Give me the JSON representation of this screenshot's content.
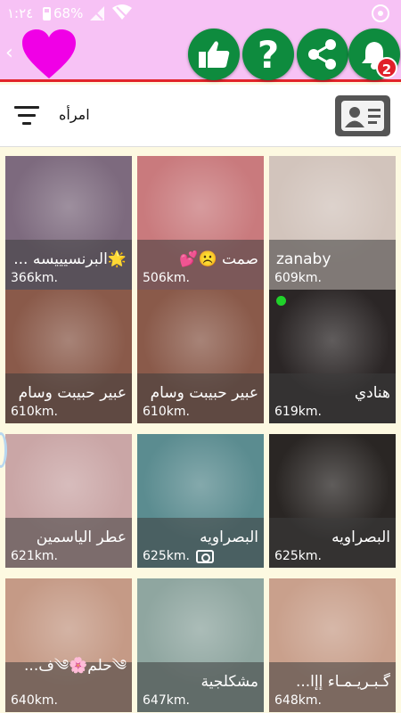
{
  "status_bar": {
    "time": "١:٢٤",
    "battery": "68%"
  },
  "filter": {
    "gender": "امرأه"
  },
  "notifications": {
    "count": "2"
  },
  "profiles": [
    {
      "name": "🌟البرنسيييسه ...",
      "distance": "366km.",
      "bg": "#7d6a7e"
    },
    {
      "name": "صمت ☹️💕",
      "distance": "506km.",
      "bg": "#c97a7d"
    },
    {
      "name": "zanaby",
      "distance": "609km.",
      "bg": "#d2c4bc"
    },
    {
      "name": "عبير حبيبت وسام",
      "distance": "610km.",
      "bg": "#8a5a4a"
    },
    {
      "name": "عبير حبيبت وسام",
      "distance": "610km.",
      "bg": "#8a5a4a"
    },
    {
      "name": "هنادي",
      "distance": "619km.",
      "bg": "#2b2626"
    },
    {
      "name": "عطر الياسمين",
      "distance": "621km.",
      "bg": "#caa6a6"
    },
    {
      "name": "البصراويه",
      "distance": "625km.",
      "bg": "#5b8c90"
    },
    {
      "name": "البصراويه",
      "distance": "625km.",
      "bg": "#2a2624"
    },
    {
      "name": "༄حلم🌸༄ف...",
      "distance": "640km.",
      "bg": "#c59a86"
    },
    {
      "name": "مشكلجية",
      "distance": "647km.",
      "bg": "#8fa6a0"
    },
    {
      "name": "گـبـريـمـاء إإا...",
      "distance": "648km.",
      "bg": "#c9a08c"
    }
  ]
}
